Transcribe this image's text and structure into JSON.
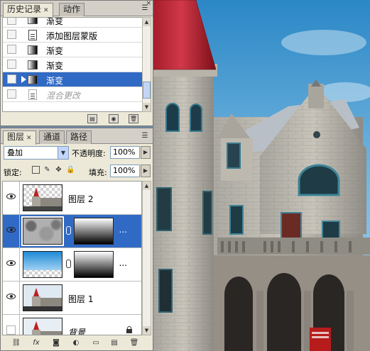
{
  "history": {
    "tabs": [
      {
        "label": "历史记录",
        "active": true
      },
      {
        "label": "动作",
        "active": false
      }
    ],
    "items": [
      {
        "label": "渐变",
        "icon": "gradient-thumb",
        "state": "normal"
      },
      {
        "label": "添加图层蒙版",
        "icon": "document-icon",
        "state": "normal"
      },
      {
        "label": "渐变",
        "icon": "gradient-thumb",
        "state": "normal"
      },
      {
        "label": "渐变",
        "icon": "gradient-thumb",
        "state": "normal"
      },
      {
        "label": "渐变",
        "icon": "gradient-thumb",
        "state": "selected"
      },
      {
        "label": "混合更改",
        "icon": "document-icon",
        "state": "dimmed"
      }
    ]
  },
  "layers": {
    "tabs": [
      {
        "label": "图层",
        "active": true
      },
      {
        "label": "通道",
        "active": false
      },
      {
        "label": "路径",
        "active": false
      }
    ],
    "blend_mode": "叠加",
    "opacity_label": "不透明度:",
    "opacity_value": "100%",
    "lock_label": "锁定:",
    "fill_label": "填充:",
    "fill_value": "100%",
    "rows": [
      {
        "name": "图层 2",
        "visible": true,
        "selected": false,
        "thumb": "castle-checker",
        "mask": false
      },
      {
        "name": "",
        "visible": true,
        "selected": true,
        "thumb": "clouds",
        "mask": true,
        "more": "..."
      },
      {
        "name": "",
        "visible": true,
        "selected": false,
        "thumb": "sky-gradient",
        "mask": true,
        "more": "..."
      },
      {
        "name": "图层 1",
        "visible": true,
        "selected": false,
        "thumb": "castle",
        "mask": false
      },
      {
        "name": "背景",
        "visible": false,
        "selected": false,
        "thumb": "castle",
        "mask": false,
        "locked": true
      }
    ]
  },
  "colors": {
    "selection": "#316ac5",
    "panel_bg": "#ece9d8"
  }
}
